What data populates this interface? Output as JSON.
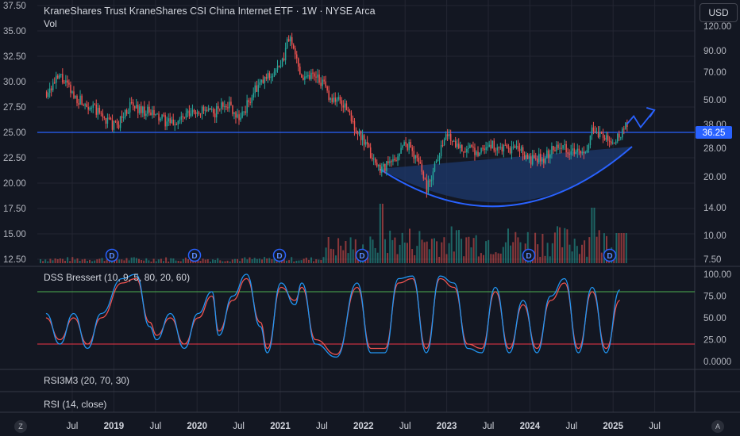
{
  "header": {
    "title": "KraneShares Trust KraneShares CSI China Internet ETF · 1W · NYSE Arca",
    "volume_label": "Vol",
    "currency": "USD"
  },
  "colors": {
    "background": "#131722",
    "grid": "#232632",
    "up": "#26a69a",
    "down": "#ef5350",
    "trendline": "#2962ff",
    "price_tag": "#2962ff",
    "dss_fast": "#2196f3",
    "dss_slow": "#ef5350",
    "overbought": "#4caf50",
    "oversold": "#f23645",
    "cup_fill": "#1e3a6e"
  },
  "chart_data": [
    {
      "type": "candlestick",
      "pane": "price",
      "y_left_ticks": [
        "37.50",
        "35.00",
        "32.50",
        "30.00",
        "27.50",
        "25.00",
        "22.50",
        "20.00",
        "17.50",
        "15.00",
        "12.50"
      ],
      "y_right_ticks": [
        "120.00",
        "90.00",
        "70.00",
        "50.00",
        "38.00",
        "28.00",
        "20.00",
        "14.00",
        "10.00",
        "7.50"
      ],
      "price_marker": "36.25",
      "x_ticks": [
        "Jul",
        "2019",
        "Jul",
        "2020",
        "Jul",
        "2021",
        "Jul",
        "2022",
        "Jul",
        "2023",
        "Jul",
        "2024",
        "Jul",
        "2025",
        "Jul"
      ],
      "dividend_marker": "D",
      "dividend_dates": [
        "2019-07",
        "2020-07",
        "2021-01",
        "2022-01",
        "2024-01",
        "2025-01"
      ],
      "close_path": [
        [
          "2018-03",
          29.0
        ],
        [
          "2018-05",
          30.5
        ],
        [
          "2018-07",
          28.5
        ],
        [
          "2018-09",
          27.8
        ],
        [
          "2018-11",
          26.6
        ],
        [
          "2019-01",
          25.5
        ],
        [
          "2019-03",
          27.6
        ],
        [
          "2019-05",
          27.2
        ],
        [
          "2019-07",
          26.5
        ],
        [
          "2019-09",
          25.8
        ],
        [
          "2019-11",
          26.5
        ],
        [
          "2020-01",
          27.2
        ],
        [
          "2020-03",
          26.8
        ],
        [
          "2020-05",
          28.0
        ],
        [
          "2020-07",
          26.4
        ],
        [
          "2020-09",
          29.0
        ],
        [
          "2020-11",
          30.5
        ],
        [
          "2021-01",
          31.5
        ],
        [
          "2021-02",
          34.5
        ],
        [
          "2021-04",
          30.5
        ],
        [
          "2021-06",
          30.8
        ],
        [
          "2021-08",
          28.5
        ],
        [
          "2021-10",
          27.8
        ],
        [
          "2021-12",
          25.0
        ],
        [
          "2022-03",
          21.5
        ],
        [
          "2022-05",
          22.0
        ],
        [
          "2022-07",
          24.0
        ],
        [
          "2022-09",
          22.0
        ],
        [
          "2022-10",
          19.5
        ],
        [
          "2022-12",
          23.5
        ],
        [
          "2023-01",
          24.8
        ],
        [
          "2023-03",
          23.5
        ],
        [
          "2023-05",
          23.0
        ],
        [
          "2023-07",
          23.8
        ],
        [
          "2023-09",
          23.2
        ],
        [
          "2023-11",
          23.4
        ],
        [
          "2024-01",
          22.2
        ],
        [
          "2024-03",
          22.5
        ],
        [
          "2024-05",
          23.9
        ],
        [
          "2024-07",
          23.2
        ],
        [
          "2024-09",
          22.6
        ],
        [
          "2024-10",
          25.6
        ],
        [
          "2024-12",
          24.2
        ],
        [
          "2025-01",
          23.8
        ],
        [
          "2025-03",
          25.8
        ]
      ],
      "horizontal_line": 25.0,
      "projection_path": [
        [
          "2025-03",
          25.8
        ],
        [
          "2025-04",
          26.6
        ],
        [
          "2025-05",
          25.5
        ],
        [
          "2025-07",
          27.2
        ]
      ]
    },
    {
      "type": "line",
      "pane": "oscillator",
      "name": "DSS Bressert (10, 9, 5, 80, 20, 60)",
      "y_ticks": [
        "100.00",
        "75.00",
        "50.00",
        "25.00",
        "0.0000"
      ],
      "ylim": [
        0,
        100
      ],
      "levels": [
        80,
        20
      ],
      "fast": [
        [
          "2018-03",
          55
        ],
        [
          "2018-05",
          20
        ],
        [
          "2018-07",
          55
        ],
        [
          "2018-09",
          15
        ],
        [
          "2018-11",
          55
        ],
        [
          "2019-02",
          95
        ],
        [
          "2019-04",
          100
        ],
        [
          "2019-06",
          40
        ],
        [
          "2019-07",
          25
        ],
        [
          "2019-09",
          55
        ],
        [
          "2019-11",
          15
        ],
        [
          "2020-01",
          55
        ],
        [
          "2020-03",
          80
        ],
        [
          "2020-04",
          30
        ],
        [
          "2020-06",
          75
        ],
        [
          "2020-08",
          100
        ],
        [
          "2020-10",
          40
        ],
        [
          "2020-11",
          10
        ],
        [
          "2021-01",
          90
        ],
        [
          "2021-03",
          65
        ],
        [
          "2021-04",
          90
        ],
        [
          "2021-06",
          20
        ],
        [
          "2021-09",
          5
        ],
        [
          "2021-12",
          90
        ],
        [
          "2022-02",
          10
        ],
        [
          "2022-04",
          10
        ],
        [
          "2022-06",
          95
        ],
        [
          "2022-08",
          98
        ],
        [
          "2022-10",
          10
        ],
        [
          "2022-12",
          98
        ],
        [
          "2023-02",
          90
        ],
        [
          "2023-04",
          15
        ],
        [
          "2023-06",
          10
        ],
        [
          "2023-08",
          85
        ],
        [
          "2023-10",
          10
        ],
        [
          "2023-12",
          70
        ],
        [
          "2024-02",
          10
        ],
        [
          "2024-04",
          75
        ],
        [
          "2024-06",
          95
        ],
        [
          "2024-08",
          10
        ],
        [
          "2024-10",
          85
        ],
        [
          "2024-12",
          10
        ],
        [
          "2025-02",
          82
        ]
      ],
      "slow": [
        [
          "2018-03",
          50
        ],
        [
          "2018-05",
          25
        ],
        [
          "2018-07",
          50
        ],
        [
          "2018-09",
          20
        ],
        [
          "2018-11",
          50
        ],
        [
          "2019-02",
          90
        ],
        [
          "2019-04",
          95
        ],
        [
          "2019-06",
          45
        ],
        [
          "2019-07",
          30
        ],
        [
          "2019-09",
          50
        ],
        [
          "2019-11",
          20
        ],
        [
          "2020-01",
          50
        ],
        [
          "2020-03",
          75
        ],
        [
          "2020-04",
          35
        ],
        [
          "2020-06",
          70
        ],
        [
          "2020-08",
          95
        ],
        [
          "2020-10",
          45
        ],
        [
          "2020-11",
          15
        ],
        [
          "2021-01",
          85
        ],
        [
          "2021-03",
          70
        ],
        [
          "2021-04",
          85
        ],
        [
          "2021-06",
          25
        ],
        [
          "2021-09",
          8
        ],
        [
          "2021-12",
          85
        ],
        [
          "2022-02",
          15
        ],
        [
          "2022-04",
          15
        ],
        [
          "2022-06",
          90
        ],
        [
          "2022-08",
          95
        ],
        [
          "2022-10",
          15
        ],
        [
          "2022-12",
          95
        ],
        [
          "2023-02",
          85
        ],
        [
          "2023-04",
          20
        ],
        [
          "2023-06",
          15
        ],
        [
          "2023-08",
          80
        ],
        [
          "2023-10",
          15
        ],
        [
          "2023-12",
          65
        ],
        [
          "2024-02",
          15
        ],
        [
          "2024-04",
          70
        ],
        [
          "2024-06",
          90
        ],
        [
          "2024-08",
          15
        ],
        [
          "2024-10",
          80
        ],
        [
          "2024-12",
          15
        ],
        [
          "2025-02",
          70
        ]
      ]
    }
  ],
  "panes": {
    "rsi3m3_label": "RSI3M3 (20, 70, 30)",
    "rsi_label": "RSI (14, close)"
  },
  "footer": {
    "left_button": "Z",
    "right_button": "A"
  }
}
